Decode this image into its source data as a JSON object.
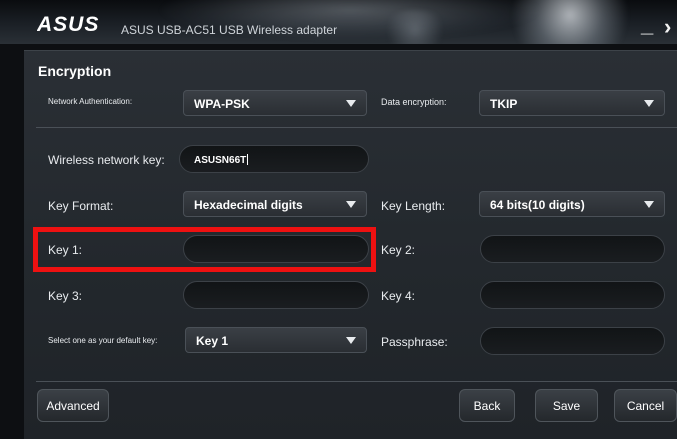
{
  "window": {
    "brand": "ASUS",
    "title": "ASUS USB-AC51 USB Wireless adapter",
    "minimize_glyph": "_",
    "close_glyph": "›"
  },
  "encryption": {
    "section_title": "Encryption",
    "network_auth": {
      "label": "Network Authentication:",
      "value": "WPA-PSK"
    },
    "data_encryption": {
      "label": "Data encryption:",
      "value": "TKIP"
    },
    "wireless_key": {
      "label": "Wireless network key:",
      "value": "ASUSN66T"
    },
    "key_format": {
      "label": "Key Format:",
      "value": "Hexadecimal digits"
    },
    "key_length": {
      "label": "Key Length:",
      "value": "64 bits(10 digits)"
    },
    "key1": {
      "label": "Key 1:",
      "value": ""
    },
    "key2": {
      "label": "Key 2:",
      "value": ""
    },
    "key3": {
      "label": "Key 3:",
      "value": ""
    },
    "key4": {
      "label": "Key 4:",
      "value": ""
    },
    "default_key": {
      "label": "Select one as your default key:",
      "value": "Key 1"
    },
    "passphrase": {
      "label": "Passphrase:",
      "value": ""
    }
  },
  "buttons": {
    "advanced": "Advanced",
    "back": "Back",
    "save": "Save",
    "cancel": "Cancel"
  },
  "colors": {
    "highlight": "#ee1111",
    "panel": "#25292e",
    "titlebar": "#0a0c0f"
  },
  "icons": {
    "dropdown": "chevron-down-icon",
    "window_close": "close-icon",
    "window_minimize": "minimize-icon"
  }
}
